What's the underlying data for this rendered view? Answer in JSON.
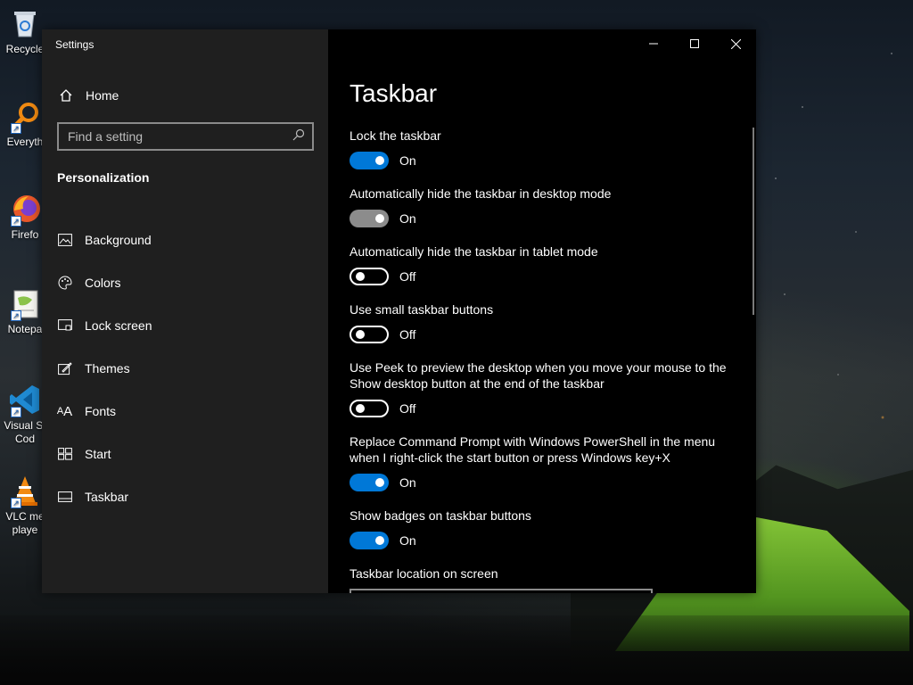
{
  "desktop": {
    "icons": [
      {
        "label": "Recycle",
        "icon": "recycle-bin-icon"
      },
      {
        "label": "Everyth",
        "icon": "everything-search-icon"
      },
      {
        "label": "Firefo",
        "icon": "firefox-icon"
      },
      {
        "label": "Notepa",
        "icon": "notepad-icon"
      },
      {
        "label": "Visual St\nCod",
        "icon": "vscode-icon"
      },
      {
        "label": "VLC me\nplaye",
        "icon": "vlc-icon"
      }
    ]
  },
  "window": {
    "title": "Settings",
    "controls": {
      "minimize": "—",
      "maximize": "☐",
      "close": "✕"
    }
  },
  "sidebar": {
    "home_label": "Home",
    "search_placeholder": "Find a setting",
    "section": "Personalization",
    "items": [
      {
        "label": "Background",
        "icon": "picture-icon"
      },
      {
        "label": "Colors",
        "icon": "palette-icon"
      },
      {
        "label": "Lock screen",
        "icon": "lock-screen-icon"
      },
      {
        "label": "Themes",
        "icon": "themes-icon"
      },
      {
        "label": "Fonts",
        "icon": "fonts-icon"
      },
      {
        "label": "Start",
        "icon": "start-icon"
      },
      {
        "label": "Taskbar",
        "icon": "taskbar-icon"
      }
    ]
  },
  "main": {
    "page_title": "Taskbar",
    "settings": [
      {
        "label": "Lock the taskbar",
        "state": "On",
        "style": "on"
      },
      {
        "label": "Automatically hide the taskbar in desktop mode",
        "state": "On",
        "style": "on-dim"
      },
      {
        "label": "Automatically hide the taskbar in tablet mode",
        "state": "Off",
        "style": "off"
      },
      {
        "label": "Use small taskbar buttons",
        "state": "Off",
        "style": "off"
      },
      {
        "label": "Use Peek to preview the desktop when you move your mouse to the Show desktop button at the end of the taskbar",
        "state": "Off",
        "style": "off"
      },
      {
        "label": "Replace Command Prompt with Windows PowerShell in the menu when I right-click the start button or press Windows key+X",
        "state": "On",
        "style": "on"
      },
      {
        "label": "Show badges on taskbar buttons",
        "state": "On",
        "style": "on"
      }
    ],
    "location_label": "Taskbar location on screen"
  },
  "colors": {
    "accent": "#0078d7",
    "toggle_disabled": "#8c8c8c"
  }
}
